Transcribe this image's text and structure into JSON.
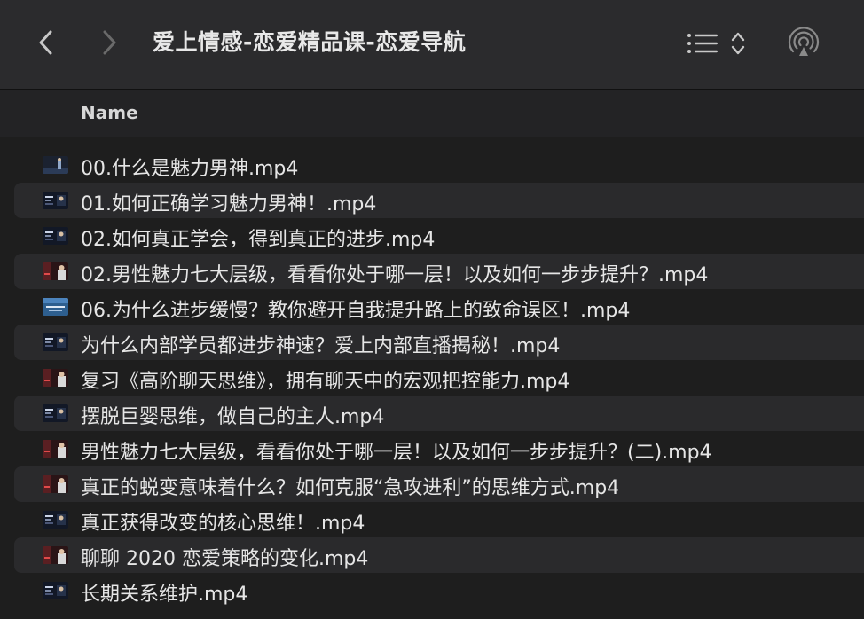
{
  "window": {
    "title": "爱上情感-恋爱精品课-恋爱导航"
  },
  "toolbar": {
    "back_icon": "chevron-left-icon",
    "forward_icon": "chevron-right-icon",
    "view_icon": "list-view-icon",
    "airdrop_icon": "airdrop-icon"
  },
  "header": {
    "name_label": "Name"
  },
  "files": [
    {
      "name": "00.什么是魅力男神.mp4",
      "thumb": "dark-figure"
    },
    {
      "name": "01.如何正确学习魅力男神！.mp4",
      "thumb": "dark-panel"
    },
    {
      "name": "02.如何真正学会，得到真正的进步.mp4",
      "thumb": "dark-panel"
    },
    {
      "name": "02.男性魅力七大层级，看看你处于哪一层！以及如何一步步提升？.mp4",
      "thumb": "red-person"
    },
    {
      "name": "06.为什么进步缓慢？教你避开自我提升路上的致命误区！.mp4",
      "thumb": "blue-slide"
    },
    {
      "name": "为什么内部学员都进步神速？爱上内部直播揭秘！.mp4",
      "thumb": "dark-panel"
    },
    {
      "name": "复习《高阶聊天思维》，拥有聊天中的宏观把控能力.mp4",
      "thumb": "red-person"
    },
    {
      "name": "摆脱巨婴思维，做自己的主人.mp4",
      "thumb": "dark-panel"
    },
    {
      "name": "男性魅力七大层级，看看你处于哪一层！以及如何一步步提升？(二).mp4",
      "thumb": "red-person"
    },
    {
      "name": "真正的蜕变意味着什么？如何克服“急攻进利”的思维方式.mp4",
      "thumb": "red-person"
    },
    {
      "name": "真正获得改变的核心思维！.mp4",
      "thumb": "dark-panel"
    },
    {
      "name": "聊聊 2020 恋爱策略的变化.mp4",
      "thumb": "red-person"
    },
    {
      "name": "长期关系维护.mp4",
      "thumb": "dark-panel"
    }
  ],
  "colors": {
    "toolbar_bg": "#2b2b2d",
    "window_bg": "#1e1e1e",
    "stripe": "#2a2a2c",
    "text": "#e6e6e6"
  }
}
